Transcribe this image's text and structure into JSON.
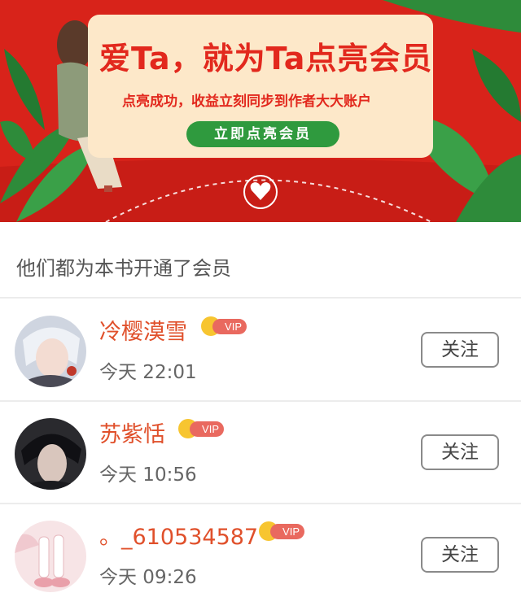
{
  "banner": {
    "headline": "爱Ta，就为Ta点亮会员",
    "subtitle": "点亮成功，收益立刻同步到作者大大账户",
    "cta_label": "立即点亮会员"
  },
  "section": {
    "title": "他们都为本书开通了会员"
  },
  "members": [
    {
      "name": "冷樱漠雪",
      "badge": "VIP",
      "time": "今天 22:01",
      "follow_label": "关注"
    },
    {
      "name": "苏紫恬",
      "badge": "VIP",
      "time": "今天 10:56",
      "follow_label": "关注"
    },
    {
      "name": "。_610534587",
      "badge": "VIP",
      "time": "今天 09:26",
      "follow_label": "关注"
    }
  ],
  "colors": {
    "banner_red": "#d8231a",
    "card_cream": "#fde8c9",
    "cta_green": "#2f9a3e",
    "name_orange": "#e0502b",
    "vip_pink": "#e9695f",
    "crown_gold": "#f7c530"
  }
}
